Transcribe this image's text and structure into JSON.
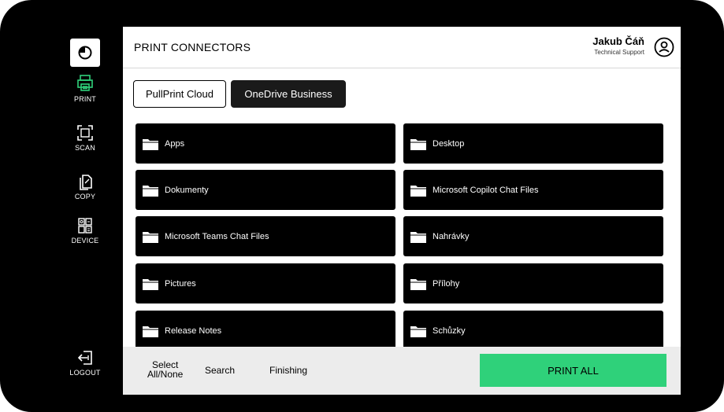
{
  "header": {
    "title": "PRINT CONNECTORS",
    "user_name": "Jakub Čáň",
    "user_role": "Technical Support"
  },
  "sidebar": {
    "items": [
      {
        "label": "PRINT",
        "icon": "printer-icon",
        "active": true
      },
      {
        "label": "SCAN",
        "icon": "scan-icon",
        "active": false
      },
      {
        "label": "COPY",
        "icon": "copy-icon",
        "active": false
      },
      {
        "label": "DEVICE",
        "icon": "device-icon",
        "active": false
      }
    ],
    "logout_label": "LOGOUT"
  },
  "tabs": [
    {
      "label": "PullPrint Cloud",
      "active": false
    },
    {
      "label": "OneDrive Business",
      "active": true
    }
  ],
  "folders": [
    "Apps",
    "Desktop",
    "Dokumenty",
    "Microsoft Copilot Chat Files",
    "Microsoft Teams Chat Files",
    "Nahrávky",
    "Pictures",
    "Přílohy",
    "Release Notes",
    "Schůzky"
  ],
  "bottom_bar": {
    "select_line1": "Select",
    "select_line2": "All/None",
    "search_label": "Search",
    "finishing_label": "Finishing",
    "print_all_label": "PRINT ALL"
  },
  "colors": {
    "accent_green": "#2fd17a",
    "print_icon_green": "#2fd17a",
    "sidebar_bg": "#000000",
    "folder_bg": "#000000"
  }
}
